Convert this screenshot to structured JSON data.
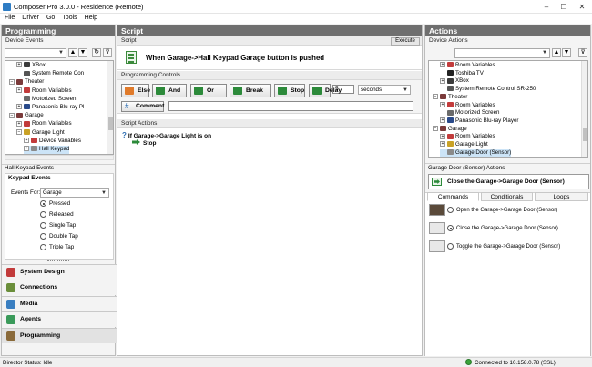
{
  "window": {
    "title": "Composer Pro 3.0.0 - Residence (Remote)",
    "controls": {
      "minimize": "–",
      "maximize": "☐",
      "close": "✕"
    }
  },
  "menu": [
    "File",
    "Driver",
    "Go",
    "Tools",
    "Help"
  ],
  "programming": {
    "header": "Programming",
    "device_events_label": "Device Events",
    "tree": [
      {
        "label": "XBox",
        "icon": "xbox-icon",
        "indent": 3,
        "expander": "+"
      },
      {
        "label": "System Remote Con",
        "icon": "remote-icon",
        "indent": 3,
        "expander": ""
      },
      {
        "label": "Theater",
        "icon": "room-icon",
        "indent": 2,
        "expander": "−"
      },
      {
        "label": "Room Variables",
        "icon": "variables-icon",
        "indent": 3,
        "expander": "+"
      },
      {
        "label": "Motorized Screen",
        "icon": "screen-icon",
        "indent": 3,
        "expander": ""
      },
      {
        "label": "Panasonic Blu-ray Pl",
        "icon": "bluray-icon",
        "indent": 3,
        "expander": "+"
      },
      {
        "label": "Garage",
        "icon": "room-icon",
        "indent": 2,
        "expander": "−"
      },
      {
        "label": "Room Variables",
        "icon": "variables-icon",
        "indent": 3,
        "expander": "+"
      },
      {
        "label": "Garage Light",
        "icon": "light-icon",
        "indent": 3,
        "expander": "−"
      },
      {
        "label": "Device Variables",
        "icon": "variables-icon",
        "indent": 4,
        "expander": "+"
      },
      {
        "label": "Hall Keypad",
        "icon": "keypad-icon",
        "indent": 4,
        "expander": "+"
      }
    ],
    "events_title": "Hall Keypad Events",
    "events_group": "Keypad Events",
    "events_for_label": "Events For:",
    "events_for_value": "Garage",
    "events": [
      {
        "label": "Pressed",
        "checked": true
      },
      {
        "label": "Released",
        "checked": false
      },
      {
        "label": "Single Tap",
        "checked": false
      },
      {
        "label": "Double Tap",
        "checked": false
      },
      {
        "label": "Triple Tap",
        "checked": false
      }
    ],
    "nav": [
      {
        "label": "System Design",
        "color": "#c23b3b"
      },
      {
        "label": "Connections",
        "color": "#6a8e3a"
      },
      {
        "label": "Media",
        "color": "#3a7fc1"
      },
      {
        "label": "Agents",
        "color": "#3a9a5a"
      },
      {
        "label": "Programming",
        "color": "#8a6a3a"
      }
    ]
  },
  "script": {
    "header": "Script",
    "sub_label": "Script",
    "execute": "Execute",
    "summary": "When Garage->Hall Keypad Garage button is pushed",
    "controls_label": "Programming Controls",
    "buttons": [
      {
        "label": "Else",
        "color": "#e07a2a"
      },
      {
        "label": "And",
        "color": "#2c8a3a"
      },
      {
        "label": "Or",
        "color": "#2c8a3a"
      },
      {
        "label": "Break",
        "color": "#2c8a3a"
      },
      {
        "label": "Stop",
        "color": "#2c8a3a"
      },
      {
        "label": "Delay",
        "color": "#2c8a3a"
      }
    ],
    "delay_value": "5",
    "delay_unit": "seconds",
    "comment_label": "Comment",
    "comment_value": "",
    "actions_label": "Script Actions",
    "actions": [
      {
        "text": "If Garage->Garage Light is on",
        "icon": "question-icon"
      },
      {
        "text": "Stop",
        "icon": "green-arrow-icon"
      }
    ]
  },
  "actions": {
    "header": "Actions",
    "device_actions_label": "Device Actions",
    "tree": [
      {
        "label": "Room Variables",
        "icon": "variables-icon",
        "indent": 3,
        "expander": "+"
      },
      {
        "label": "Toshiba TV",
        "icon": "tv-icon",
        "indent": 3,
        "expander": ""
      },
      {
        "label": "XBox",
        "icon": "xbox-icon",
        "indent": 3,
        "expander": "+"
      },
      {
        "label": "System Remote Control SR-250",
        "icon": "remote-icon",
        "indent": 3,
        "expander": ""
      },
      {
        "label": "Theater",
        "icon": "room-icon",
        "indent": 2,
        "expander": "−"
      },
      {
        "label": "Room Variables",
        "icon": "variables-icon",
        "indent": 3,
        "expander": "+"
      },
      {
        "label": "Motorized Screen",
        "icon": "screen-icon",
        "indent": 3,
        "expander": ""
      },
      {
        "label": "Panasonic Blu-ray Player",
        "icon": "bluray-icon",
        "indent": 3,
        "expander": "+"
      },
      {
        "label": "Garage",
        "icon": "room-icon",
        "indent": 2,
        "expander": "−"
      },
      {
        "label": "Room Variables",
        "icon": "variables-icon",
        "indent": 3,
        "expander": "+"
      },
      {
        "label": "Garage Light",
        "icon": "light-icon",
        "indent": 3,
        "expander": "+"
      },
      {
        "label": "Garage Door (Sensor)",
        "icon": "door-icon",
        "indent": 3,
        "expander": ""
      }
    ],
    "selected_title": "Garage Door (Sensor) Actions",
    "selected_action": "Close the Garage->Garage Door (Sensor)",
    "tabs": [
      "Commands",
      "Conditionals",
      "Loops"
    ],
    "active_tab": 0,
    "commands": [
      {
        "label": "Open the Garage->Garage Door (Sensor)",
        "checked": false
      },
      {
        "label": "Close the Garage->Garage Door (Sensor)",
        "checked": true
      },
      {
        "label": "Toggle the Garage->Garage Door (Sensor)",
        "checked": false
      }
    ]
  },
  "status": {
    "left": "Director Status: Idle",
    "right": "Connected to 10.158.0.78 (SSL)"
  },
  "colors": {
    "panel_header": "#6f6f6f",
    "selection": "#cce4f7",
    "accent_blue": "#2e7cc4"
  }
}
